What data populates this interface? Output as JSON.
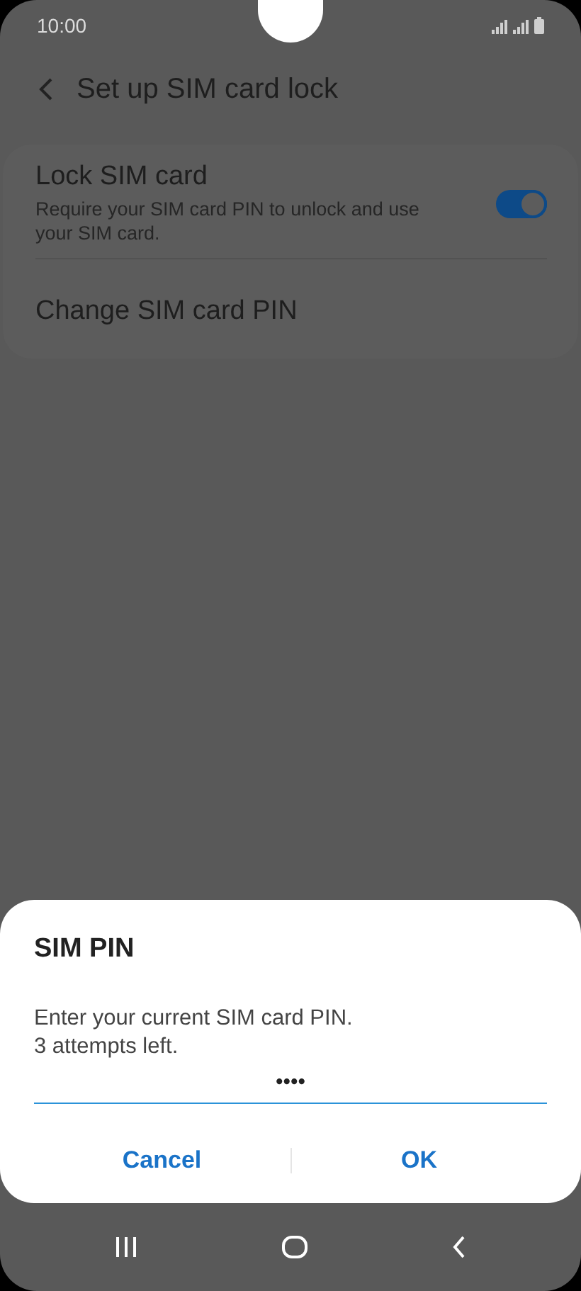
{
  "status_bar": {
    "time": "10:00"
  },
  "header": {
    "title": "Set up SIM card lock"
  },
  "settings": [
    {
      "kind": "toggle",
      "title": "Lock SIM card",
      "subtitle": "Require your SIM card PIN to unlock and use your SIM card.",
      "on": true
    },
    {
      "kind": "plain",
      "title": "Change SIM card PIN"
    }
  ],
  "dialog": {
    "title": "SIM PIN",
    "message": "Enter your current SIM card PIN.",
    "attempts": "3 attempts left.",
    "pin_value": "••••",
    "buttons": [
      "Cancel",
      "OK"
    ]
  }
}
